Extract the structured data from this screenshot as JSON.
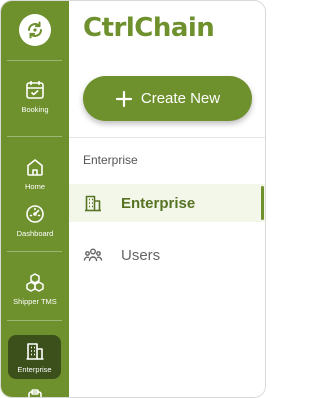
{
  "app": {
    "name": "CtrlChain"
  },
  "colors": {
    "primary": "#6e902d",
    "primary_dark": "#3c501b",
    "active_bg": "#f3f7ea"
  },
  "rail": {
    "logo_icon": "sync-logo-icon",
    "items": [
      {
        "label": "Booking",
        "icon": "calendar-icon"
      },
      {
        "label": "Home",
        "icon": "home-icon"
      },
      {
        "label": "Dashboard",
        "icon": "speedometer-icon"
      },
      {
        "label": "Shipper TMS",
        "icon": "boxes-icon"
      },
      {
        "label": "Enterprise",
        "icon": "building-icon",
        "active": true
      },
      {
        "label": "",
        "icon": "clipboard-icon"
      }
    ]
  },
  "panel": {
    "create_button_label": "Create New",
    "section_title": "Enterprise",
    "nav": [
      {
        "label": "Enterprise",
        "icon": "building-icon",
        "active": true
      },
      {
        "label": "Users",
        "icon": "users-icon",
        "active": false
      }
    ]
  }
}
